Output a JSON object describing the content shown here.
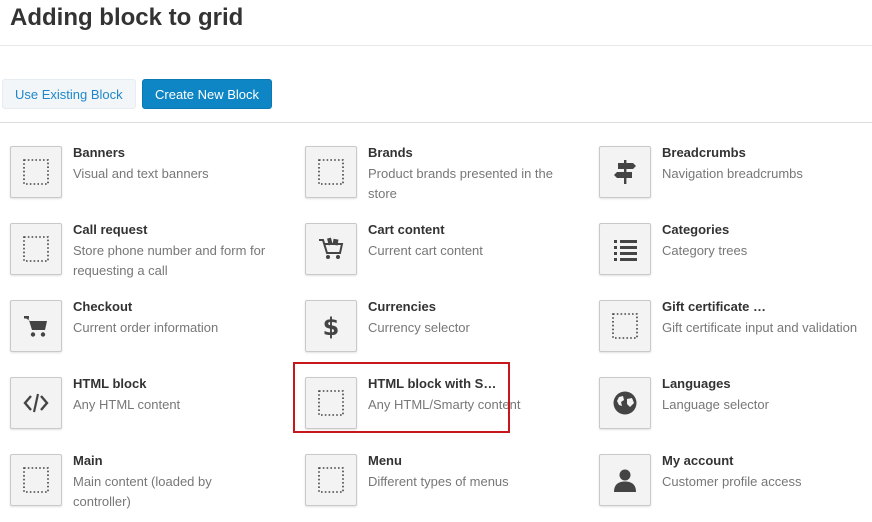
{
  "page": {
    "title": "Adding block to grid"
  },
  "tabs": {
    "use_existing": "Use Existing Block",
    "create_new": "Create New Block"
  },
  "blocks": [
    {
      "name": "Banners",
      "desc": "Visual and text banners",
      "icon": "dotted-square-icon"
    },
    {
      "name": "Brands",
      "desc": "Product brands presented in the store",
      "icon": "dotted-square-icon"
    },
    {
      "name": "Breadcrumbs",
      "desc": "Navigation breadcrumbs",
      "icon": "signpost-icon"
    },
    {
      "name": "Call request",
      "desc": "Store phone number and form for requesting a call",
      "icon": "dotted-square-icon"
    },
    {
      "name": "Cart content",
      "desc": "Current cart content",
      "icon": "cart-full-icon"
    },
    {
      "name": "Categories",
      "desc": "Category trees",
      "icon": "list-icon"
    },
    {
      "name": "Checkout",
      "desc": "Current order information",
      "icon": "cart-icon"
    },
    {
      "name": "Currencies",
      "desc": "Currency selector",
      "icon": "dollar-icon"
    },
    {
      "name": "Gift certificate …",
      "desc": "Gift certificate input and validation",
      "icon": "dotted-square-icon"
    },
    {
      "name": "HTML block",
      "desc": "Any HTML content",
      "icon": "code-icon"
    },
    {
      "name": "HTML block with S…",
      "desc": "Any HTML/Smarty content",
      "icon": "dotted-square-icon",
      "selected": true
    },
    {
      "name": "Languages",
      "desc": "Language selector",
      "icon": "globe-icon"
    },
    {
      "name": "Main",
      "desc": "Main content (loaded by controller)",
      "icon": "dotted-square-icon"
    },
    {
      "name": "Menu",
      "desc": "Different types of menus",
      "icon": "dotted-square-icon"
    },
    {
      "name": "My account",
      "desc": "Customer profile access",
      "icon": "user-icon"
    }
  ],
  "colors": {
    "accent": "#0e85c4",
    "highlight": "#c8161d",
    "icon": "#444444"
  }
}
